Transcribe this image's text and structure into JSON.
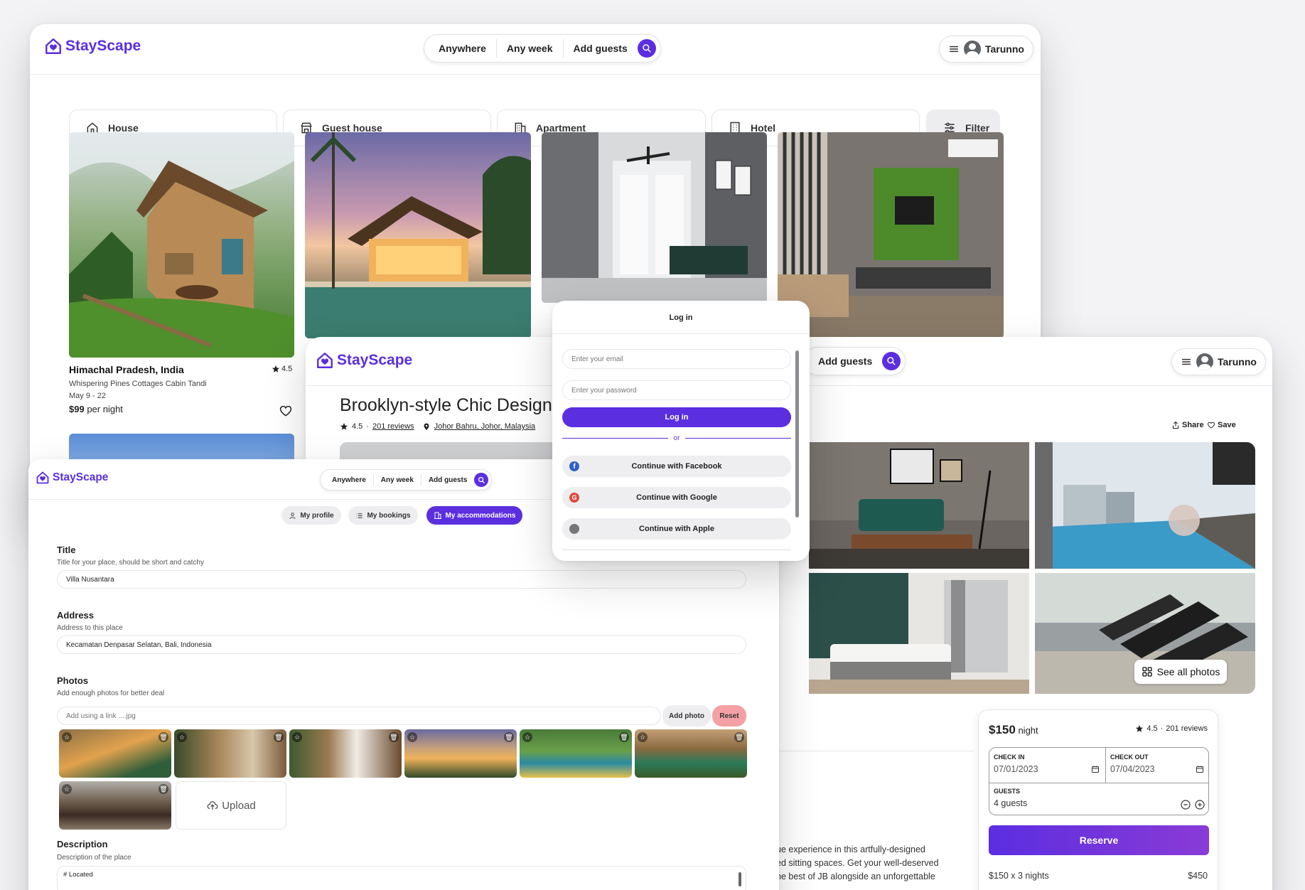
{
  "brand": {
    "name": "StayScape",
    "accent": "#5b2ee0"
  },
  "search": {
    "where": "Anywhere",
    "when": "Any week",
    "who": "Add guests"
  },
  "user": {
    "name": "Tarunno"
  },
  "categories": [
    {
      "label": "House",
      "icon": "house-icon"
    },
    {
      "label": "Guest house",
      "icon": "guest-house-icon"
    },
    {
      "label": "Apartment",
      "icon": "apartment-icon"
    },
    {
      "label": "Hotel",
      "icon": "hotel-icon"
    }
  ],
  "filter_label": "Filter",
  "listing": {
    "location": "Himachal Pradesh, India",
    "rating": "4.5",
    "name": "Whispering Pines Cottages Cabin Tandi",
    "dates": "May 9 - 22",
    "price": "$99",
    "price_unit": "per night"
  },
  "detail": {
    "title": "Brooklyn-style Chic Designer",
    "rating": "4.5",
    "reviews": "201 reviews",
    "address": "Johor Bahru, Johor, Malaysia",
    "share": "Share",
    "save": "Save",
    "see_all": "See all photos",
    "desc_lines": [
      "ue experience in this artfully-designed",
      "ed sitting spaces. Get your well-deserved",
      "he best of JB alongside an unforgettable"
    ]
  },
  "booking": {
    "price": "$150",
    "unit": "night",
    "rating": "4.5",
    "reviews": "201 reviews",
    "checkin_label": "CHECK IN",
    "checkin": "07/01/2023",
    "checkout_label": "CHECK OUT",
    "checkout": "07/04/2023",
    "guests_label": "GUESTS",
    "guests": "4 guests",
    "reserve": "Reserve",
    "line_label": "$150 x 3 nights",
    "line_total": "$450"
  },
  "login": {
    "title": "Log in",
    "email_placeholder": "Enter your email",
    "password_placeholder": "Enter your password",
    "submit": "Log in",
    "or": "or",
    "facebook": "Continue with Facebook",
    "google": "Continue with Google",
    "apple": "Continue with Apple"
  },
  "account": {
    "tabs": [
      "My profile",
      "My bookings",
      "My accommodations"
    ],
    "title_label": "Title",
    "title_hint": "Title for your place, should be short and catchy",
    "title_value": "Villa Nusantara",
    "address_label": "Address",
    "address_hint": "Address to this place",
    "address_value": "Kecamatan Denpasar Selatan, Bali, Indonesia",
    "photos_label": "Photos",
    "photos_hint": "Add enough photos for better deal",
    "link_placeholder": "Add using a link ....jpg",
    "add_photo": "Add photo",
    "reset": "Reset",
    "upload": "Upload",
    "description_label": "Description",
    "description_hint": "Description of the place",
    "description_value": "# Located"
  }
}
